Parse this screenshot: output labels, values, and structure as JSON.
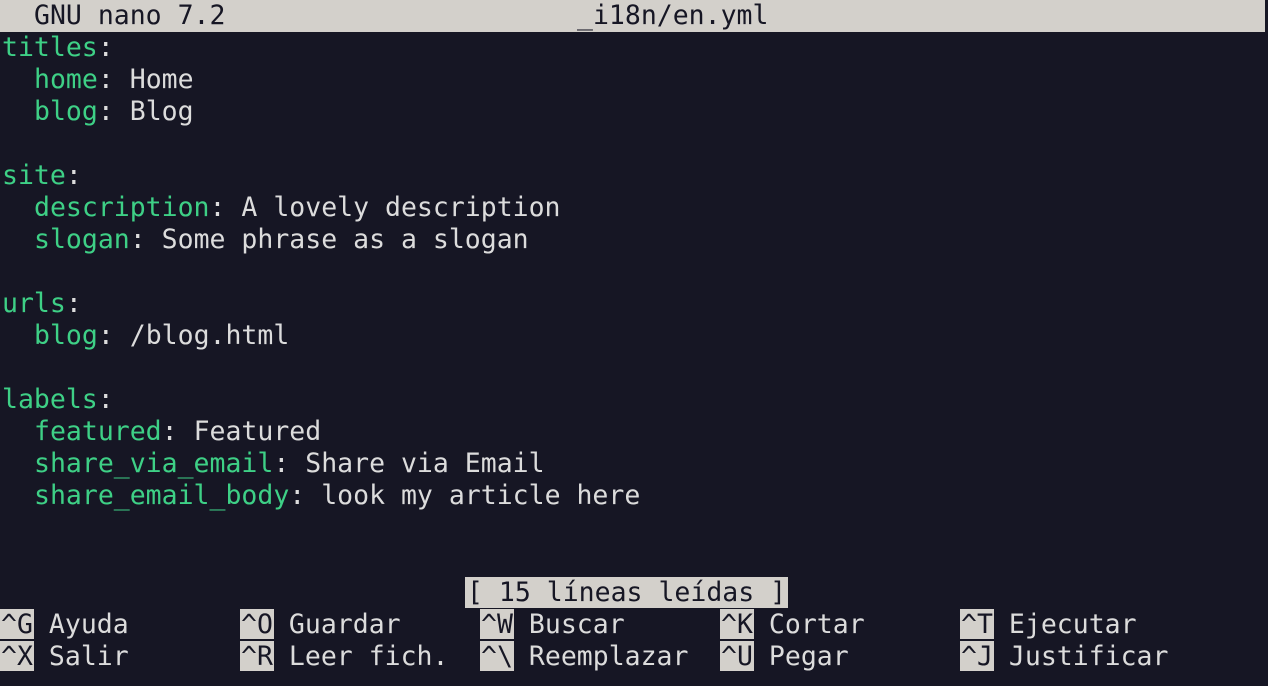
{
  "titlebar": {
    "app": "GNU nano 7.2",
    "file": "_i18n/en.yml"
  },
  "lines": [
    {
      "indent": false,
      "key": "titles",
      "value": ""
    },
    {
      "indent": true,
      "key": "home",
      "value": "Home"
    },
    {
      "indent": true,
      "key": "blog",
      "value": "Blog"
    },
    {
      "blank": true
    },
    {
      "indent": false,
      "key": "site",
      "value": ""
    },
    {
      "indent": true,
      "key": "description",
      "value": "A lovely description"
    },
    {
      "indent": true,
      "key": "slogan",
      "value": "Some phrase as a slogan"
    },
    {
      "blank": true
    },
    {
      "indent": false,
      "key": "urls",
      "value": ""
    },
    {
      "indent": true,
      "key": "blog",
      "value": "/blog.html"
    },
    {
      "blank": true
    },
    {
      "indent": false,
      "key": "labels",
      "value": ""
    },
    {
      "indent": true,
      "key": "featured",
      "value": "Featured"
    },
    {
      "indent": true,
      "key": "share_via_email",
      "value": "Share via Email"
    },
    {
      "indent": true,
      "key": "share_email_body",
      "value": "look my article here"
    }
  ],
  "status": "[ 15 líneas leídas ]",
  "shortcuts": {
    "row1": [
      {
        "key": "^G",
        "label": "Ayuda"
      },
      {
        "key": "^O",
        "label": "Guardar"
      },
      {
        "key": "^W",
        "label": "Buscar"
      },
      {
        "key": "^K",
        "label": "Cortar"
      },
      {
        "key": "^T",
        "label": "Ejecutar"
      }
    ],
    "row2": [
      {
        "key": "^X",
        "label": "Salir"
      },
      {
        "key": "^R",
        "label": "Leer fich."
      },
      {
        "key": "^\\",
        "label": "Reemplazar"
      },
      {
        "key": "^U",
        "label": "Pegar"
      },
      {
        "key": "^J",
        "label": "Justificar"
      }
    ]
  },
  "colors": {
    "background": "#161624",
    "key": "#3ed086",
    "text": "#dcdcdc",
    "bar": "#d3d0cb"
  }
}
